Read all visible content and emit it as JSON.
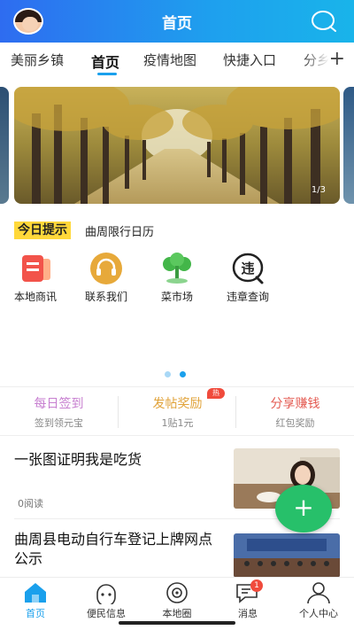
{
  "header": {
    "title": "首页"
  },
  "tabs": [
    {
      "label": "美丽乡镇"
    },
    {
      "label": "首页"
    },
    {
      "label": "疫情地图"
    },
    {
      "label": "快捷入口"
    },
    {
      "label": "分乡"
    }
  ],
  "banner": {
    "counter": "1/3"
  },
  "tip": {
    "badge": "今日提示",
    "text": "曲周限行日历"
  },
  "quick_links": [
    {
      "label": "本地商讯",
      "icon": "news-icon"
    },
    {
      "label": "联系我们",
      "icon": "headset-icon"
    },
    {
      "label": "菜市场",
      "icon": "vegetable-icon"
    },
    {
      "label": "违章查询",
      "icon": "violation-icon",
      "glyph": "违"
    }
  ],
  "rewards": [
    {
      "title": "每日签到",
      "sub": "签到领元宝",
      "color": "#c77fd0"
    },
    {
      "title": "发帖奖励",
      "sub": "1贴1元",
      "color": "#e1a33a",
      "hot": "热"
    },
    {
      "title": "分享赚钱",
      "sub": "红包奖励",
      "color": "#e45b52"
    }
  ],
  "feed": [
    {
      "title": "一张图证明我是吃货",
      "meta": "0阅读"
    },
    {
      "title": "曲周县电动自行车登记上牌网点公示",
      "meta": ""
    }
  ],
  "fab": {
    "label": "+"
  },
  "bottom_nav": [
    {
      "label": "首页",
      "icon": "home-icon"
    },
    {
      "label": "便民信息",
      "icon": "service-icon"
    },
    {
      "label": "本地圈",
      "icon": "circle-icon"
    },
    {
      "label": "消息",
      "icon": "message-icon",
      "badge": "1"
    },
    {
      "label": "个人中心",
      "icon": "person-icon"
    }
  ],
  "colors": {
    "accent": "#1aa0ec",
    "fab": "#27c06a",
    "tip_badge": "#ffd83a"
  }
}
